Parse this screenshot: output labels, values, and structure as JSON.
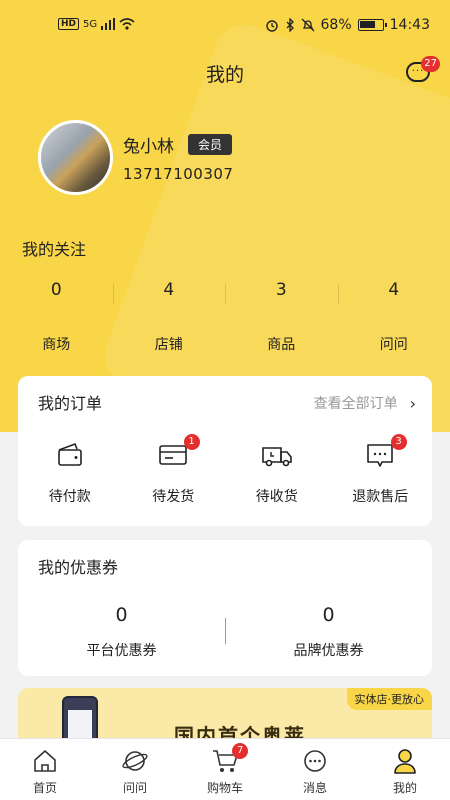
{
  "status_bar": {
    "network": "HD",
    "signal": "5G",
    "battery": "68%",
    "time": "14:43"
  },
  "header": {
    "title": "我的",
    "message_count": "27"
  },
  "profile": {
    "name": "兔小林",
    "member_badge": "会员",
    "phone": "13717100307"
  },
  "follow": {
    "title": "我的关注",
    "items": [
      {
        "value": "0",
        "label": "商场"
      },
      {
        "value": "4",
        "label": "店铺"
      },
      {
        "value": "3",
        "label": "商品"
      },
      {
        "value": "4",
        "label": "问问"
      }
    ]
  },
  "orders": {
    "title": "我的订单",
    "view_all": "查看全部订单",
    "items": [
      {
        "label": "待付款",
        "icon": "wallet-icon",
        "badge": ""
      },
      {
        "label": "待发货",
        "icon": "card-icon",
        "badge": "1"
      },
      {
        "label": "待收货",
        "icon": "truck-icon",
        "badge": ""
      },
      {
        "label": "退款售后",
        "icon": "service-icon",
        "badge": "3"
      }
    ]
  },
  "coupons": {
    "title": "我的优惠券",
    "items": [
      {
        "value": "0",
        "label": "平台优惠券"
      },
      {
        "value": "0",
        "label": "品牌优惠券"
      }
    ]
  },
  "banner": {
    "tag": "实体店·更放心",
    "headline": "国内首个奥莱"
  },
  "tabbar": {
    "items": [
      {
        "label": "首页",
        "icon": "home-icon",
        "badge": ""
      },
      {
        "label": "问问",
        "icon": "planet-icon",
        "badge": ""
      },
      {
        "label": "购物车",
        "icon": "cart-icon",
        "badge": "7"
      },
      {
        "label": "消息",
        "icon": "chat-icon",
        "badge": ""
      },
      {
        "label": "我的",
        "icon": "user-icon",
        "badge": ""
      }
    ]
  },
  "colors": {
    "accent": "#f9d548",
    "badge": "#e52e2e"
  }
}
